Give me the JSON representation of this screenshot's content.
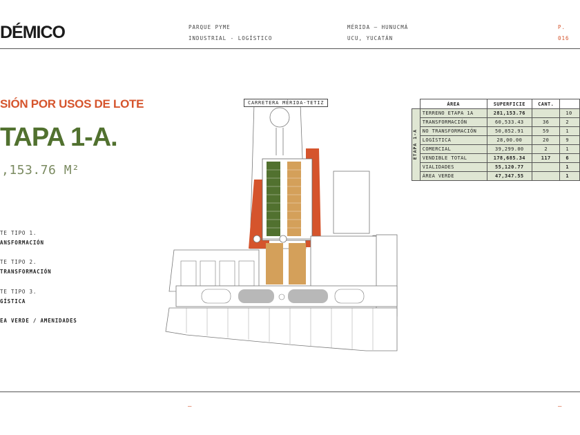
{
  "header": {
    "logo": "DÉMICO",
    "project_line1": "PARQUE PYME",
    "project_line2": "INDUSTRIAL - LOGÍSTICO",
    "location_line1": "MÉRIDA — HUNUCMÁ",
    "location_line2": "UCU, YUCATÁN",
    "page": "P. 016"
  },
  "main": {
    "section_title": "SIÓN POR USOS DE LOTE",
    "stage_title": "TAPA 1-A.",
    "area_total": ",153.76 M²"
  },
  "legend": [
    {
      "line1": "TE TIPO 1.",
      "line2": "ANSFORMACIÓN"
    },
    {
      "line1": "TE TIPO 2.",
      "line2": "TRANSFORMACIÓN"
    },
    {
      "line1": "TE TIPO 3.",
      "line2": "GÍSTICA"
    },
    {
      "line1": "EA VERDE / AMENIDADES",
      "line2": ""
    }
  ],
  "map": {
    "road_label": "CARRETERA MÉRIDA-TETIZ"
  },
  "table": {
    "side_label": "ETAPA 1-A",
    "headers": [
      "ÁREA",
      "SUPERFICIE",
      "CANT.",
      ""
    ],
    "rows": [
      {
        "area": "TERRENO ETAPA 1A",
        "superficie": "281,153.76",
        "cant": "",
        "extra": "10",
        "bold": true
      },
      {
        "area": "TRANSFORMACIÓN",
        "superficie": "60,533.43",
        "cant": "36",
        "extra": "2",
        "bold": false
      },
      {
        "area": "NO TRANSFORMACIÓN",
        "superficie": "50,852.91",
        "cant": "59",
        "extra": "1",
        "bold": false
      },
      {
        "area": "LOGÍSTICA",
        "superficie": "28,00.00",
        "cant": "20",
        "extra": "9",
        "bold": false
      },
      {
        "area": "COMERCIAL",
        "superficie": "39,299.00",
        "cant": "2",
        "extra": "1",
        "bold": false
      },
      {
        "area": "VENDIBLE TOTAL",
        "superficie": "178,685.34",
        "cant": "117",
        "extra": "6",
        "bold": true
      },
      {
        "area": "VIALIDADES",
        "superficie": "55,120.77",
        "cant": "",
        "extra": "1",
        "bold": true
      },
      {
        "area": "ÁREA VERDE",
        "superficie": "47,347.55",
        "cant": "",
        "extra": "1",
        "bold": true
      }
    ]
  },
  "footer": {
    "mark_left": "—",
    "mark_right": "—"
  },
  "colors": {
    "orange": "#d5542c",
    "green": "#51712f",
    "tan": "#d4a05a",
    "grey": "#b8b8b8"
  }
}
